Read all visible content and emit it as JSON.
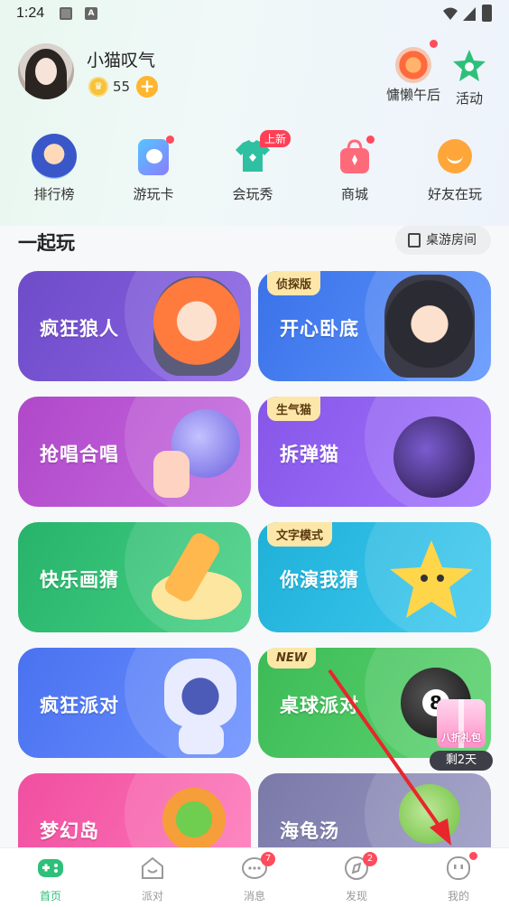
{
  "status_bar": {
    "time": "1:24"
  },
  "user": {
    "name": "小猫叹气",
    "coins": "55",
    "coin_add": "+"
  },
  "top_actions": [
    {
      "label": "慵懒午后"
    },
    {
      "label": "活动"
    }
  ],
  "quick_menu": [
    {
      "label": "排行榜"
    },
    {
      "label": "游玩卡"
    },
    {
      "label": "会玩秀",
      "badge": "上新"
    },
    {
      "label": "商城"
    },
    {
      "label": "好友在玩"
    }
  ],
  "section": {
    "title": "一起玩",
    "room_button": "桌游房间"
  },
  "games": [
    {
      "title": "疯狂狼人",
      "tag": ""
    },
    {
      "title": "开心卧底",
      "tag": "侦探版"
    },
    {
      "title": "抢唱合唱",
      "tag": ""
    },
    {
      "title": "拆弹猫",
      "tag": "生气猫"
    },
    {
      "title": "快乐画猜",
      "tag": ""
    },
    {
      "title": "你演我猜",
      "tag": "文字模式"
    },
    {
      "title": "疯狂派对",
      "tag": ""
    },
    {
      "title": "桌球派对",
      "tag": "NEW"
    },
    {
      "title": "梦幻岛",
      "tag": ""
    },
    {
      "title": "海龟汤",
      "tag": ""
    }
  ],
  "promo": {
    "gift_label": "八折礼包",
    "days_left": "剩2天"
  },
  "nav": [
    {
      "label": "首页",
      "badge": ""
    },
    {
      "label": "派对",
      "badge": ""
    },
    {
      "label": "消息",
      "badge": "7"
    },
    {
      "label": "发现",
      "badge": "2"
    },
    {
      "label": "我的",
      "badge": ""
    }
  ],
  "colors": {
    "accent": "#2ec07a",
    "badge": "#ff4b5c"
  }
}
